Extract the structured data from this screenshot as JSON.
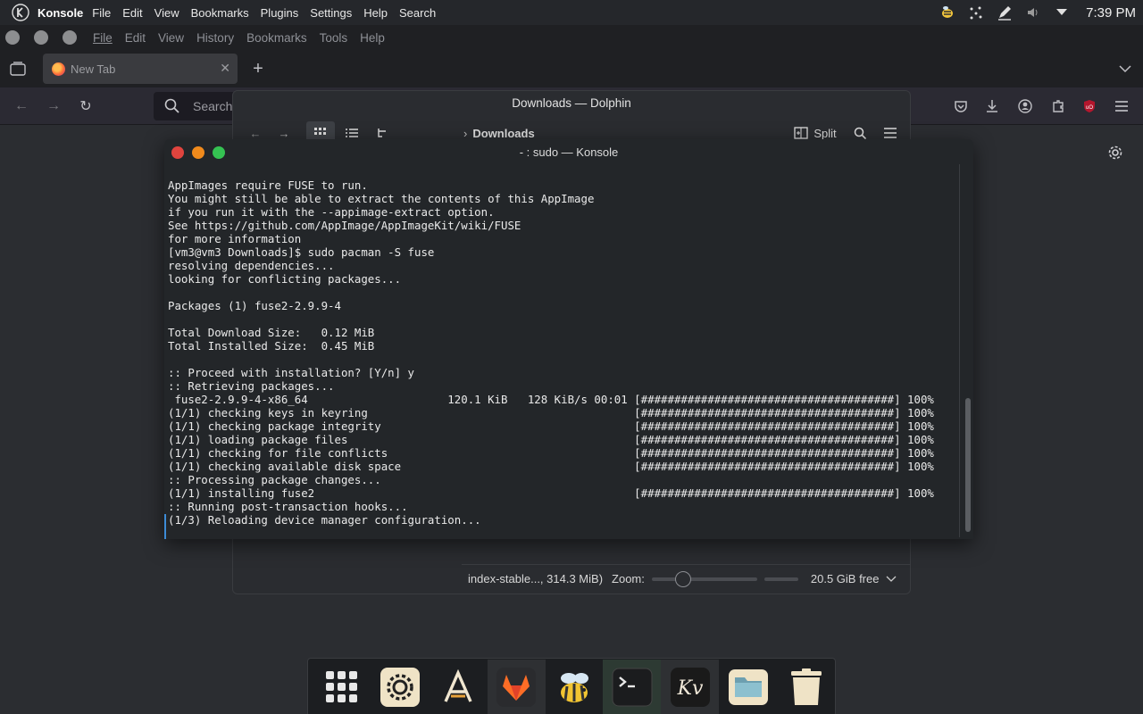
{
  "top_panel": {
    "app_name": "Konsole",
    "menu": [
      "File",
      "Edit",
      "View",
      "Bookmarks",
      "Plugins",
      "Settings",
      "Help",
      "Search"
    ],
    "clock": "7:39 PM"
  },
  "firefox": {
    "menu": [
      "File",
      "Edit",
      "View",
      "History",
      "Bookmarks",
      "Tools",
      "Help"
    ],
    "tab_title": "New Tab",
    "search_placeholder": "Search"
  },
  "dolphin": {
    "title": "Downloads — Dolphin",
    "breadcrumb": "Downloads",
    "split_label": "Split",
    "status_file": "index-stable..., 314.3 MiB)",
    "zoom_label": "Zoom:",
    "free_space": "20.5 GiB free"
  },
  "konsole": {
    "title": "- : sudo — Konsole",
    "lines": [
      "AppImages require FUSE to run.",
      "You might still be able to extract the contents of this AppImage",
      "if you run it with the --appimage-extract option.",
      "See https://github.com/AppImage/AppImageKit/wiki/FUSE",
      "for more information",
      "[vm3@vm3 Downloads]$ sudo pacman -S fuse",
      "resolving dependencies...",
      "looking for conflicting packages...",
      "",
      "Packages (1) fuse2-2.9.9-4",
      "",
      "Total Download Size:   0.12 MiB",
      "Total Installed Size:  0.45 MiB",
      "",
      ":: Proceed with installation? [Y/n] y",
      ":: Retrieving packages...",
      " fuse2-2.9.9-4-x86_64                     120.1 KiB   128 KiB/s 00:01 [######################################] 100%",
      "(1/1) checking keys in keyring                                        [######################################] 100%",
      "(1/1) checking package integrity                                      [######################################] 100%",
      "(1/1) loading package files                                           [######################################] 100%",
      "(1/1) checking for file conflicts                                     [######################################] 100%",
      "(1/1) checking available disk space                                   [######################################] 100%",
      ":: Processing package changes...",
      "(1/1) installing fuse2                                                [######################################] 100%",
      ":: Running post-transaction hooks...",
      "(1/3) Reloading device manager configuration..."
    ]
  },
  "dock": {
    "items": [
      "app-grid",
      "settings",
      "font-app",
      "gitlab",
      "bee-app",
      "terminal",
      "kv-app",
      "files",
      "trash"
    ],
    "kv_text": "Kv"
  }
}
